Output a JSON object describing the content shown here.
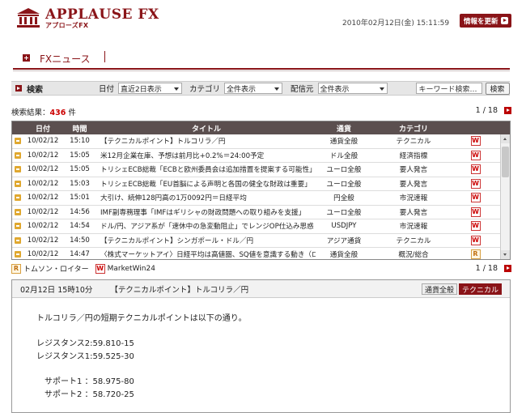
{
  "header": {
    "brand_name": "APPLAUSE FX",
    "brand_sub": "アプローズFX",
    "datetime": "2010年02月12日(金) 15:11:59",
    "refresh_label": "情報を更新"
  },
  "section": {
    "title": "FXニュース"
  },
  "search": {
    "title": "検索",
    "date_label": "日付",
    "date_value": "直近2日表示",
    "category_label": "カテゴリ",
    "category_value": "全件表示",
    "source_label": "配信元",
    "source_value": "全件表示",
    "keyword_placeholder": "キーワード検索…",
    "button": "検索"
  },
  "results": {
    "prefix": "検索結果：",
    "count": "436",
    "suffix": "件",
    "page": "1 / 18"
  },
  "table": {
    "headers": {
      "date": "日付",
      "time": "時間",
      "title": "タイトル",
      "currency": "通貨",
      "category": "カテゴリ"
    },
    "rows": [
      {
        "date": "10/02/12",
        "time": "15:10",
        "title": "【テクニカルポイント】トルコリラ／円",
        "currency": "通貨全般",
        "category": "テクニカル",
        "source": "W"
      },
      {
        "date": "10/02/12",
        "time": "15:05",
        "title": "米12月企業在庫、予想は前月比+0.2%＝24:00予定",
        "currency": "ドル全般",
        "category": "経済指標",
        "source": "W"
      },
      {
        "date": "10/02/12",
        "time": "15:05",
        "title": "トリシェECB総裁「ECBと欧州委員会は追加措置を提案する可能性」",
        "currency": "ユーロ全般",
        "category": "要人発言",
        "source": "W"
      },
      {
        "date": "10/02/12",
        "time": "15:03",
        "title": "トリシェECB総裁「EU首脳による声明と各国の健全な財政は重要」",
        "currency": "ユーロ全般",
        "category": "要人発言",
        "source": "W"
      },
      {
        "date": "10/02/12",
        "time": "15:01",
        "title": "大引け、続伸128円高の1万0092円＝日経平均",
        "currency": "円全般",
        "category": "市況速報",
        "source": "W"
      },
      {
        "date": "10/02/12",
        "time": "14:56",
        "title": "IMF副専務理事「IMFはギリシャの財政問題への取り組みを支援」",
        "currency": "ユーロ全般",
        "category": "要人発言",
        "source": "W"
      },
      {
        "date": "10/02/12",
        "time": "14:54",
        "title": "ドル/円、アジア系が「速休中の急変動阻止」でレンジOP仕込み思惑",
        "currency": "USDJPY",
        "category": "市況速報",
        "source": "W"
      },
      {
        "date": "10/02/12",
        "time": "14:50",
        "title": "【テクニカルポイント】シンガポール・ドル／円",
        "currency": "アジア通貨",
        "category": "テクニカル",
        "source": "W"
      },
      {
        "date": "10/02/12",
        "time": "14:47",
        "title": "〈株式マーケットアイ〉日経平均は高値圏、SQ値を意識する動き（ロイター）",
        "currency": "通貨全般",
        "category": "概況/総合",
        "source": "R"
      }
    ]
  },
  "legend": {
    "reuters": "トムソン・ロイター",
    "marketwin": "MarketWin24",
    "page": "1 / 18"
  },
  "detail": {
    "time": "02月12日 15時10分",
    "title": "【テクニカルポイント】トルコリラ／円",
    "tag_currency": "通貨全般",
    "tag_category": "テクニカル",
    "intro": "トルコリラ／円の短期テクニカルポイントは以下の通り。",
    "r2": "レジスタンス2:59.810-15",
    "r1": "レジスタンス1:59.525-30",
    "s1": "サポート1 ：58.975-80",
    "s2": "サポート2 ：58.720-25"
  },
  "colors": {
    "brand": "#8a1418",
    "table_header": "#5b4f4f",
    "count": "#cc0000"
  },
  "icons": {
    "logo": "temple-icon",
    "row": "news-item-icon",
    "pager": "arrow-right-icon"
  }
}
